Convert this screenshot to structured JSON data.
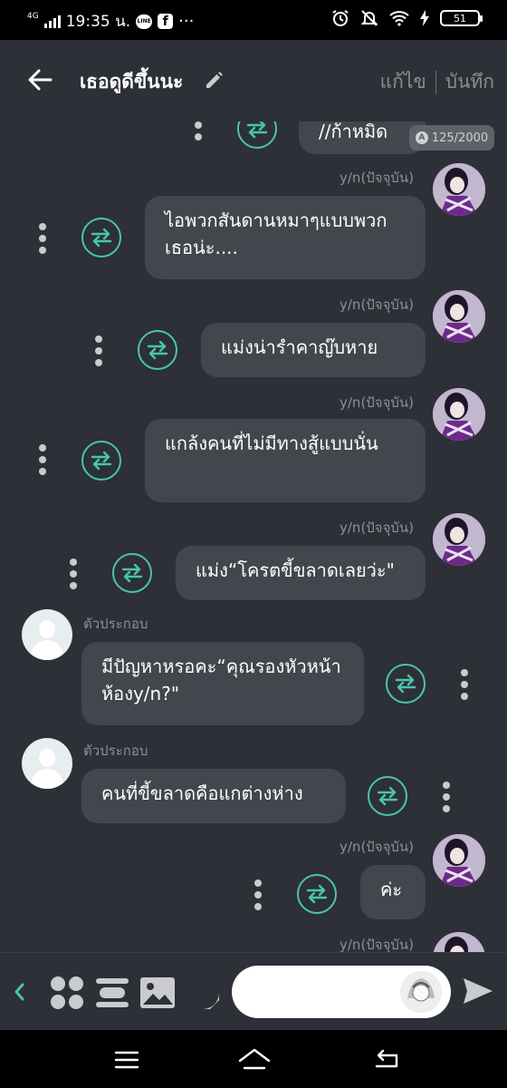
{
  "status_bar": {
    "network": "4G",
    "time": "19:35 น.",
    "line_badge": "LINE",
    "facebook_badge": "f",
    "more": "···",
    "battery": "51"
  },
  "header": {
    "title": "เธอดูดีขึ้นนะ",
    "edit_label": "แก้ไข",
    "save_label": "บันทึก"
  },
  "chat": {
    "counter": "125/2000",
    "messages": [
      {
        "sender": "",
        "text": "//ก้าหมิด"
      },
      {
        "sender": "y/n(ปัจจุบัน)",
        "text": "ไอพวกสันดานหมาๆแบบพวกเธอน่ะ...."
      },
      {
        "sender": "y/n(ปัจจุบัน)",
        "text": "แม่งน่ารำคาญ๊บหาย"
      },
      {
        "sender": "y/n(ปัจจุบัน)",
        "text": "แกล้งคนที่ไม่มีทางสู้แบบนั่น"
      },
      {
        "sender": "y/n(ปัจจุบัน)",
        "text": "แม่ง“โครตขี้ขลาดเลยว่ะ\""
      },
      {
        "sender": "ตัวประกอบ",
        "text": "มีปัญหาหรอคะ“คุณรองหัวหน้าห้องy/n?\""
      },
      {
        "sender": "ตัวประกอบ",
        "text": "คนที่ขี้ขลาดคือแกต่างห่าง"
      },
      {
        "sender": "y/n(ปัจจุบัน)",
        "text": "ค่ะ"
      },
      {
        "sender": "y/n(ปัจจุบัน)",
        "text": ""
      }
    ]
  },
  "input": {
    "placeholder": ""
  },
  "colors": {
    "background": "#2d3036",
    "bubble": "#43464c",
    "accent": "#49c4b0"
  },
  "icons": [
    "back-arrow-icon",
    "pencil-icon",
    "swap-icon",
    "more-vertical-icon",
    "grid-icon",
    "menu-icon",
    "image-icon",
    "sticker-icon",
    "send-icon",
    "chevron-left-icon"
  ]
}
